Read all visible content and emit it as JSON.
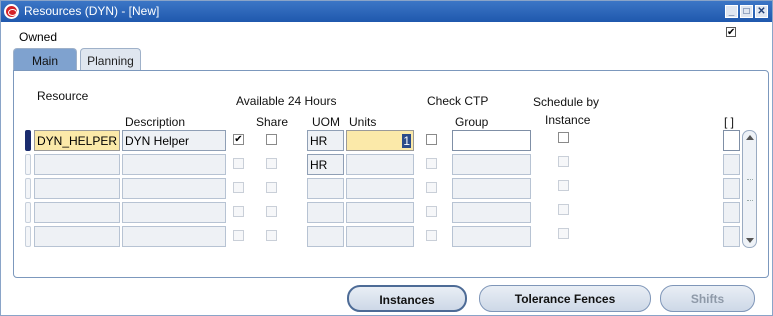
{
  "window": {
    "title": "Resources (DYN) - [New]",
    "minimize_glyph": "_",
    "maximize_glyph": "□",
    "close_glyph": "✕"
  },
  "owned": {
    "label": "Owned",
    "checked": true,
    "check_glyph": "✔"
  },
  "tabs": [
    {
      "label": "Main",
      "active": true
    },
    {
      "label": "Planning",
      "active": false
    }
  ],
  "headers": {
    "resource": "Resource",
    "description": "Description",
    "available_24": "Available 24 Hours",
    "share": "Share",
    "uom": "UOM",
    "units": "Units",
    "check_ctp": "Check CTP",
    "group": "Group",
    "schedule_by": "Schedule by",
    "instance": "Instance",
    "folder_bracket": "[ ]"
  },
  "rows": [
    {
      "resource": "DYN_HELPER",
      "description": "DYN Helper",
      "available_24": true,
      "share": false,
      "uom": "HR",
      "units": "1",
      "check_ctp": false,
      "group": "",
      "schedule_by_instance": false
    },
    {
      "resource": "",
      "description": "",
      "available_24": false,
      "share": false,
      "uom": "HR",
      "units": "",
      "check_ctp": false,
      "group": "",
      "schedule_by_instance": false
    },
    {
      "resource": "",
      "description": "",
      "available_24": false,
      "share": false,
      "uom": "",
      "units": "",
      "check_ctp": false,
      "group": "",
      "schedule_by_instance": false
    },
    {
      "resource": "",
      "description": "",
      "available_24": false,
      "share": false,
      "uom": "",
      "units": "",
      "check_ctp": false,
      "group": "",
      "schedule_by_instance": false
    },
    {
      "resource": "",
      "description": "",
      "available_24": false,
      "share": false,
      "uom": "",
      "units": "",
      "check_ctp": false,
      "group": "",
      "schedule_by_instance": false
    }
  ],
  "buttons": {
    "instances": "Instances",
    "tolerance_fences": "Tolerance Fences",
    "shifts": "Shifts"
  },
  "colors": {
    "titlebar": "#2b66b8",
    "focus_field": "#fbe9a9",
    "tab_active": "#7fa2cf"
  }
}
